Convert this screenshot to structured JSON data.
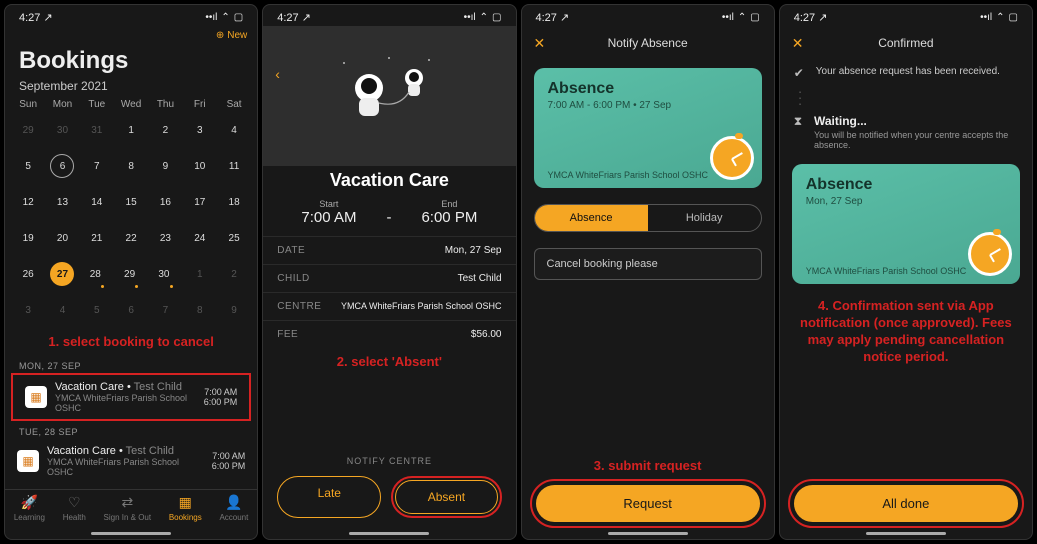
{
  "status": {
    "time": "4:27",
    "arrow": "↗"
  },
  "screen1": {
    "new": "New",
    "title": "Bookings",
    "month": "September 2021",
    "weekdays": [
      "Sun",
      "Mon",
      "Tue",
      "Wed",
      "Thu",
      "Fri",
      "Sat"
    ],
    "grid": [
      [
        {
          "n": "29",
          "m": true
        },
        {
          "n": "30",
          "m": true
        },
        {
          "n": "31",
          "m": true
        },
        {
          "n": "1"
        },
        {
          "n": "2"
        },
        {
          "n": "3"
        },
        {
          "n": "4"
        }
      ],
      [
        {
          "n": "5"
        },
        {
          "n": "6",
          "ring": true
        },
        {
          "n": "7"
        },
        {
          "n": "8"
        },
        {
          "n": "9"
        },
        {
          "n": "10"
        },
        {
          "n": "11"
        }
      ],
      [
        {
          "n": "12"
        },
        {
          "n": "13"
        },
        {
          "n": "14"
        },
        {
          "n": "15"
        },
        {
          "n": "16"
        },
        {
          "n": "17"
        },
        {
          "n": "18"
        }
      ],
      [
        {
          "n": "19"
        },
        {
          "n": "20"
        },
        {
          "n": "21"
        },
        {
          "n": "22"
        },
        {
          "n": "23"
        },
        {
          "n": "24"
        },
        {
          "n": "25"
        }
      ],
      [
        {
          "n": "26"
        },
        {
          "n": "27",
          "fill": true
        },
        {
          "n": "28",
          "dot": true
        },
        {
          "n": "29",
          "dot": true
        },
        {
          "n": "30",
          "dot": true
        },
        {
          "n": "1",
          "m": true
        },
        {
          "n": "2",
          "m": true
        }
      ],
      [
        {
          "n": "3",
          "m": true
        },
        {
          "n": "4",
          "m": true
        },
        {
          "n": "5",
          "m": true
        },
        {
          "n": "6",
          "m": true
        },
        {
          "n": "7",
          "m": true
        },
        {
          "n": "8",
          "m": true
        },
        {
          "n": "9",
          "m": true
        }
      ]
    ],
    "caption": "1. select booking to cancel",
    "day1": "MON, 27 SEP",
    "day2": "TUE, 28 SEP",
    "booking": {
      "title": "Vacation Care",
      "child": "Test Child",
      "org": "YMCA WhiteFriars Parish School  OSHC",
      "t1": "7:00 AM",
      "t2": "6:00 PM"
    },
    "tabs": [
      "Learning",
      "Health",
      "Sign In & Out",
      "Bookings",
      "Account"
    ]
  },
  "screen2": {
    "title": "Vacation Care",
    "startLabel": "Start",
    "startVal": "7:00 AM",
    "endLabel": "End",
    "endVal": "6:00 PM",
    "rows": {
      "date": {
        "k": "DATE",
        "v": "Mon, 27 Sep"
      },
      "child": {
        "k": "CHILD",
        "v": "Test Child"
      },
      "centre": {
        "k": "CENTRE",
        "v": "YMCA WhiteFriars Parish School  OSHC"
      },
      "fee": {
        "k": "FEE",
        "v": "$56.00"
      }
    },
    "caption": "2. select 'Absent'",
    "notify": "NOTIFY CENTRE",
    "late": "Late",
    "absent": "Absent"
  },
  "screen3": {
    "hdr": "Notify Absence",
    "card": {
      "title": "Absence",
      "sub": "7:00 AM - 6:00 PM • 27 Sep",
      "org": "YMCA WhiteFriars Parish School  OSHC"
    },
    "segA": "Absence",
    "segB": "Holiday",
    "field": "Cancel booking please",
    "caption": "3. submit request",
    "btn": "Request"
  },
  "screen4": {
    "hdr": "Confirmed",
    "line1": "Your absence request has been received.",
    "wait": {
      "t": "Waiting...",
      "s": "You will be notified when your centre accepts the absence."
    },
    "card": {
      "title": "Absence",
      "sub": "Mon, 27 Sep",
      "org": "YMCA WhiteFriars Parish School  OSHC"
    },
    "caption": "4. Confirmation sent via App notification (once approved). Fees may apply pending cancellation notice period.",
    "btn": "All done"
  }
}
